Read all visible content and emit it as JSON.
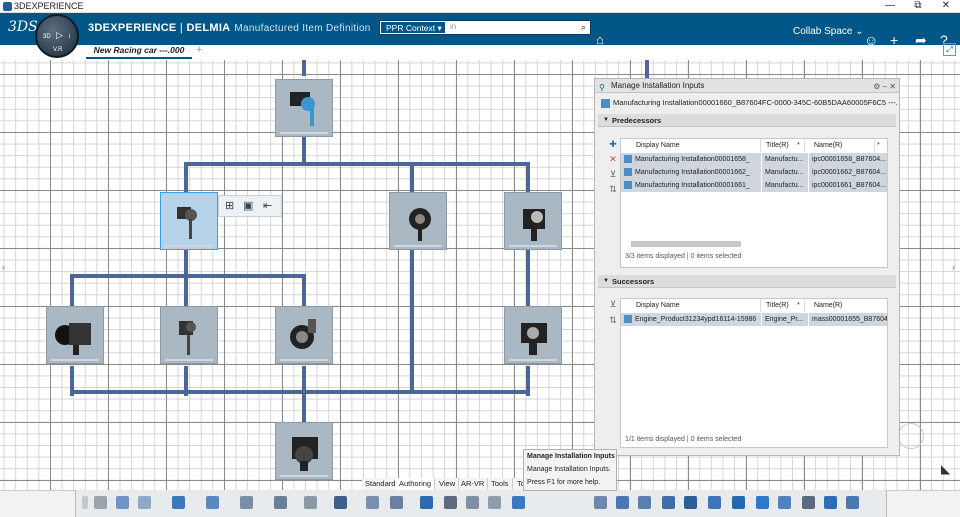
{
  "titlebar": {
    "title": "3DEXPERIENCE",
    "controls": [
      "—",
      "⧉",
      "✕"
    ]
  },
  "topbar": {
    "brand": "3DEXPERIENCE",
    "separator": " | ",
    "app": "DELMIA",
    "app_title": "Manufactured Item Definition",
    "collab_space": "Collab Space ⌄",
    "compass": {
      "v": "V.R",
      "left": "3D",
      "right": "i"
    }
  },
  "search": {
    "context": "PPR Context ▾",
    "placeholder": "in"
  },
  "tabs": [
    {
      "label": "New Racing car ---.000"
    }
  ],
  "tab_add": "+",
  "panel": {
    "title": "Manage Installation Inputs",
    "installation": "Manufacturing Installation00001660_B87604FC-0000-345C-60B5DAA60005F6C5 ---.000 (...",
    "predecessors": {
      "section": "Predecessors",
      "columns": [
        "Display Name",
        "Title(R)",
        "*",
        "Name(R)",
        "*"
      ],
      "rows": [
        {
          "display": "Manufacturing Installation00001658_",
          "title": "Manufactu...",
          "name": "ipc00001658_B87604..."
        },
        {
          "display": "Manufacturing Installation00001662_",
          "title": "Manufactu...",
          "name": "ipc00001662_B87604..."
        },
        {
          "display": "Manufacturing Installation00001661_",
          "title": "Manufactu...",
          "name": "ipc00001661_B87604..."
        }
      ],
      "status": "3/3 items displayed | 0 items selected"
    },
    "successors": {
      "section": "Successors",
      "columns": [
        "Display Name",
        "Title(R)",
        "*",
        "Name(R)"
      ],
      "rows": [
        {
          "display": "Engine_Product31234ypd16114-15986",
          "title": "Engine_Pr...",
          "name": "mass00001655_B87604..."
        }
      ],
      "status": "1/1 items displayed | 0 items selected"
    }
  },
  "tooltip": {
    "title": "Manage Installation Inputs",
    "desc": "Manage Installation Inputs.",
    "help": "Press F1 for more help."
  },
  "bottom_tabs": [
    "Standard",
    "Authoring",
    "View",
    "AR-VR",
    "Tools",
    "To"
  ],
  "colors": {
    "brand": "#005686",
    "connector": "#4c6796",
    "node": "#aab8c4",
    "selected": "#3aa0e6"
  }
}
